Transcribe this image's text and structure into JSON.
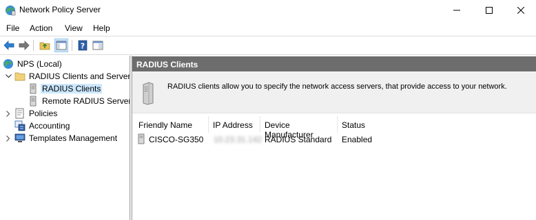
{
  "window": {
    "title": "Network Policy Server",
    "icon": "nps-globe-icon"
  },
  "menu": [
    "File",
    "Action",
    "View",
    "Help"
  ],
  "toolbar": {
    "buttons": [
      "back-arrow-icon",
      "forward-arrow-icon",
      "up-folder-icon",
      "show-hide-console-tree-icon",
      "help-icon",
      "properties-pane-icon"
    ]
  },
  "tree": {
    "root": "NPS (Local)",
    "items": [
      {
        "label": "RADIUS Clients and Servers",
        "expanded": true
      },
      {
        "label": "RADIUS Clients",
        "selected": true
      },
      {
        "label": "Remote RADIUS Server"
      },
      {
        "label": "Policies",
        "expanded": false
      },
      {
        "label": "Accounting"
      },
      {
        "label": "Templates Management",
        "expanded": false
      }
    ]
  },
  "main": {
    "header": "RADIUS Clients",
    "description": "RADIUS clients allow you to specify the network access servers, that provide access to your network.",
    "columns": [
      "Friendly Name",
      "IP Address",
      "Device Manufacturer",
      "Status"
    ],
    "rows": [
      {
        "friendly_name": "CISCO-SG350",
        "ip_address": "10.23.31.142",
        "manufacturer": "RADIUS Standard",
        "status": "Enabled"
      }
    ]
  },
  "colors": {
    "header_bar": "#6d6d6d",
    "selection": "#cce8ff",
    "info_panel": "#f0f0f0"
  }
}
